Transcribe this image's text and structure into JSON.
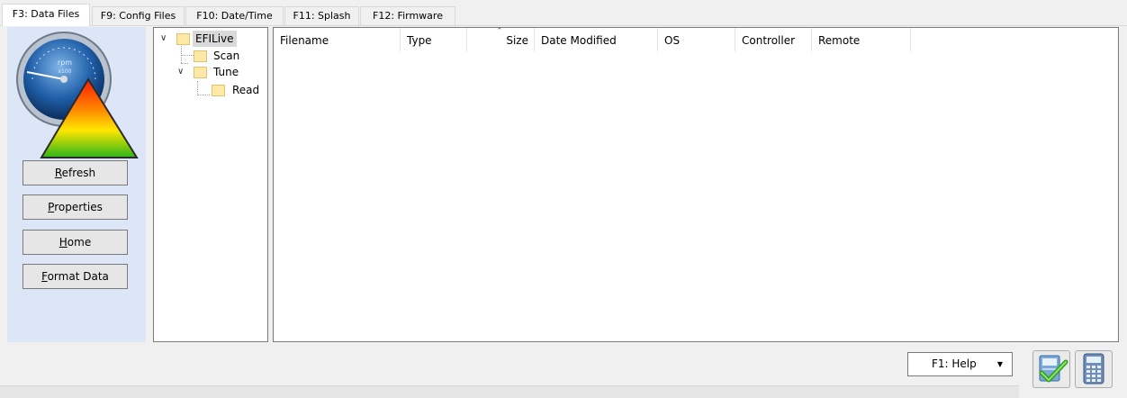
{
  "tabs": [
    {
      "label": "F3: Data Files",
      "active": true
    },
    {
      "label": "F9: Config Files",
      "active": false
    },
    {
      "label": "F10: Date/Time",
      "active": false
    },
    {
      "label": "F11: Splash",
      "active": false
    },
    {
      "label": "F12: Firmware",
      "active": false
    }
  ],
  "logo": {
    "gauge_text": "rpm",
    "gauge_subtext": "x100"
  },
  "sidebar": {
    "buttons": [
      {
        "accel": "R",
        "rest": "efresh"
      },
      {
        "accel": "P",
        "rest": "roperties"
      },
      {
        "accel": "H",
        "rest": "ome"
      },
      {
        "accel": "F",
        "rest": "ormat Data"
      }
    ]
  },
  "tree": {
    "root": "EFILive",
    "children": [
      "Scan",
      "Tune"
    ],
    "grandchild": "Read"
  },
  "file_list": {
    "columns": [
      "Filename",
      "Type",
      "Size",
      "Date Modified",
      "OS",
      "Controller",
      "Remote"
    ],
    "sorted_column": "Size",
    "rows": []
  },
  "footer": {
    "help_label": "F1: Help",
    "help_caret": "▼"
  },
  "colors": {
    "sidebar_bg": "#dde6f6",
    "selection_bg": "#d9d9d9",
    "folder_fill": "#fde9a5"
  }
}
